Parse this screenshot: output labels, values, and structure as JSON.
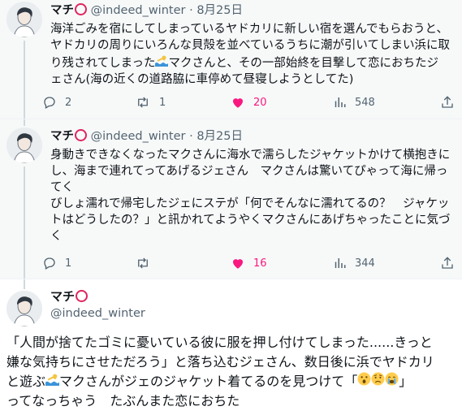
{
  "tweets": [
    {
      "name": "マチ",
      "handle": "@indeed_winter",
      "dot": "·",
      "date": "8月25日",
      "lines": [
        "海洋ごみを宿にしてしまっているヤドカリに新しい宿を選んでもらおうと、",
        "ヤドカリの周りにいろんな貝殻を並べているうちに潮が引いてしまい浜に取",
        "り残されてしまった",
        "マクさんと、その一部始終を目撃して恋におちたジ",
        "ェさん(海の近くの道路脇に車停めて昼寝しようとしてた)"
      ],
      "replies": "2",
      "retweets": "1",
      "likes": "20",
      "views": "548"
    },
    {
      "name": "マチ",
      "handle": "@indeed_winter",
      "dot": "·",
      "date": "8月25日",
      "lines": [
        "身動きできなくなったマクさんに海水で濡らしたジャケットかけて横抱きに",
        "し、海まで連れてってあげるジェさん　マクさんは驚いてぴゃって海に帰っ",
        "てく",
        "びしょ濡れで帰宅したジェにステが「何でそんなに濡れてるの？　ジャケッ",
        "トはどうしたの？」と訊かれてようやくマクさんにあげちゃったことに気づ",
        "く"
      ],
      "replies": "1",
      "retweets": "",
      "likes": "16",
      "views": "344"
    },
    {
      "name": "マチ",
      "handle": "@indeed_winter",
      "lines": [
        "「人間が捨てたゴミに憂いている彼に服を押し付けてしまった......きっと",
        "嫌な気持ちにさせただろう」と落ち込むジェさん、数日後に浜でヤドカリ",
        "と遊ぶ",
        "マクさんがジェのジャケット着てるのを見つけて「",
        "」",
        "ってなっちゃう　たぶんまた恋におちた"
      ]
    }
  ],
  "icons": {
    "reply": "reply-icon",
    "retweet": "retweet-icon",
    "like": "heart-icon",
    "views": "views-icon",
    "share": "share-icon",
    "swimmer": "swimmer-emoji",
    "emoji": [
      "astonished-emoji",
      "worried-emoji",
      "crying-emoji"
    ]
  },
  "colors": {
    "text": "#0f1419",
    "secondary": "#536471",
    "like": "#f91880",
    "circle": "#e0245e",
    "bg_thread": "#f7f9f9"
  }
}
